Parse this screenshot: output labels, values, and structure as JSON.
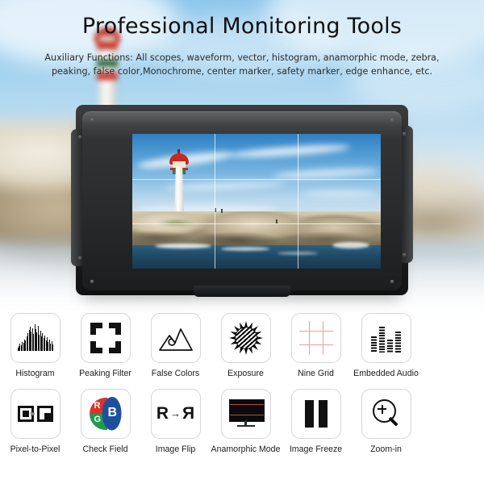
{
  "header": {
    "title": "Professional Monitoring Tools",
    "subtitle": "Auxiliary Functions: All scopes, waveform, vector, histogram, anamorphic mode, zebra, peaking, false color,Monochrome, center marker, safety marker, edge enhance, etc."
  },
  "device": {
    "name": "camera-field-monitor",
    "screen_content": "lighthouse on rocky coast with nine-grid overlay",
    "overlay": "nine-grid"
  },
  "colors": {
    "sky": "#8cc6ec",
    "page_background": "#ffffff",
    "tile_border": "#d6d6d6",
    "grid_red": "#e8a0a0",
    "check_red": "#d9342b",
    "check_green": "#219a4e",
    "check_blue": "#1d4f9e",
    "anamorphic_line": "#b8474a",
    "icon_black": "#111111",
    "arrow_gray": "#8b8b8b"
  },
  "features": {
    "row1": [
      {
        "label": "Histogram",
        "icon": "histogram-icon"
      },
      {
        "label": "Peaking Filter",
        "icon": "peaking-filter-icon"
      },
      {
        "label": "False Colors",
        "icon": "false-colors-icon"
      },
      {
        "label": "Exposure",
        "icon": "exposure-zebra-sun-icon"
      },
      {
        "label": "Nine Grid",
        "icon": "nine-grid-icon"
      },
      {
        "label": "Embedded Audio",
        "icon": "embedded-audio-icon"
      }
    ],
    "row2": [
      {
        "label": "Pixel-to-Pixel",
        "icon": "pixel-to-pixel-icon"
      },
      {
        "label": "Check Field",
        "icon": "check-field-icon"
      },
      {
        "label": "Image Flip",
        "icon": "image-flip-icon"
      },
      {
        "label": "Anamorphic Mode",
        "icon": "anamorphic-mode-icon"
      },
      {
        "label": "Image Freeze",
        "icon": "image-freeze-icon"
      },
      {
        "label": "Zoom-in",
        "icon": "zoom-in-icon"
      }
    ]
  },
  "icon_details": {
    "check_field_channels": [
      "R",
      "G",
      "B"
    ],
    "image_flip_glyph": "R",
    "image_flip_arrow": "→",
    "histogram_bars": [
      4,
      6,
      9,
      7,
      11,
      10,
      14,
      13,
      18,
      22,
      26,
      30,
      24,
      28,
      21,
      33,
      27,
      23,
      31,
      20,
      25,
      18,
      22,
      16,
      19,
      13,
      17,
      11,
      14,
      9,
      12,
      8
    ],
    "audio_bars": [
      20,
      32,
      16,
      26
    ]
  }
}
